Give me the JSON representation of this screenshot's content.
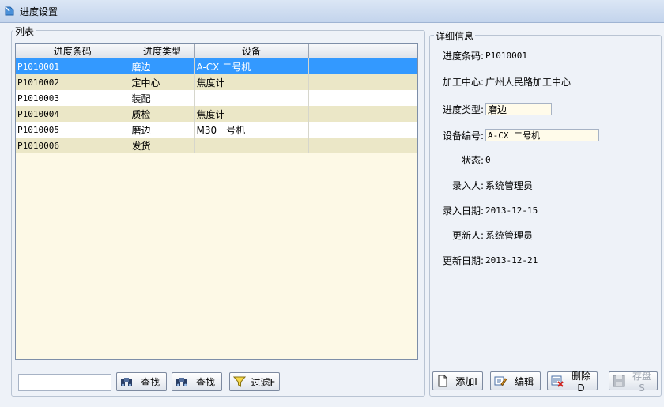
{
  "window": {
    "title": "进度设置"
  },
  "list": {
    "group_title": "列表",
    "columns": [
      "进度条码",
      "进度类型",
      "设备"
    ],
    "rows": [
      {
        "code": "P1010001",
        "type": "磨边",
        "device": "A-CX 二号机"
      },
      {
        "code": "P1010002",
        "type": "定中心",
        "device": "焦度计"
      },
      {
        "code": "P1010003",
        "type": "装配",
        "device": ""
      },
      {
        "code": "P1010004",
        "type": "质检",
        "device": "焦度计"
      },
      {
        "code": "P1010005",
        "type": "磨边",
        "device": "M30一号机"
      },
      {
        "code": "P1010006",
        "type": "发货",
        "device": ""
      }
    ],
    "search_value": "",
    "buttons": {
      "find1": "查找",
      "find2": "查找",
      "filter": "过滤F"
    }
  },
  "detail": {
    "group_title": "详细信息",
    "code_label": "进度条码:",
    "code_value": "P1010001",
    "center_label": "加工中心:",
    "center_value": "广州人民路加工中心",
    "type_label": "进度类型:",
    "type_value": "磨边",
    "device_label": "设备编号:",
    "device_value": "A-CX 二号机",
    "status_label": "状态:",
    "status_value": "0",
    "creator_label": "录入人:",
    "creator_value": "系统管理员",
    "created_label": "录入日期:",
    "created_value": "2013-12-15",
    "updater_label": "更新人:",
    "updater_value": "系统管理员",
    "updated_label": "更新日期:",
    "updated_value": "2013-12-21"
  },
  "actions": {
    "add": "添加I",
    "edit": "编辑",
    "delete": "删除D",
    "save": "存盘S"
  },
  "colors": {
    "selected_row": "#3399ff",
    "alt_row": "#ebe7c7",
    "grid_bg": "#fdf9e6"
  }
}
